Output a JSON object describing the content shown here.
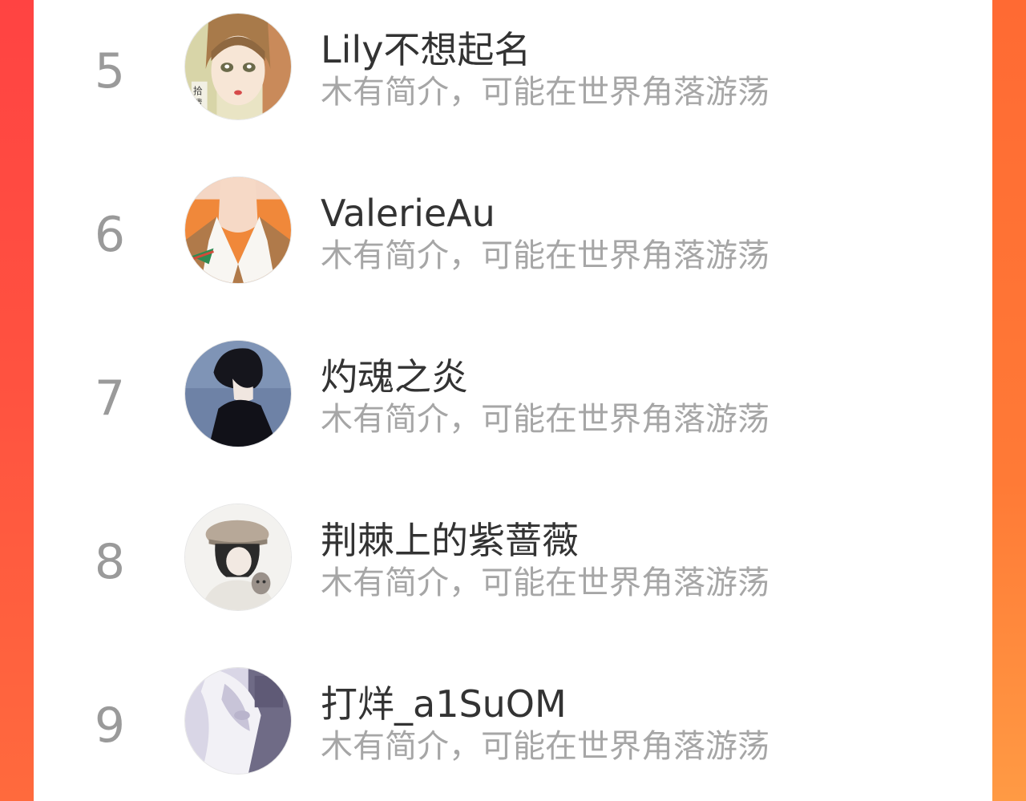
{
  "list": {
    "items": [
      {
        "rank": "5",
        "name": "Lily不想起名",
        "bio": "木有简介，可能在世界角落游荡",
        "avatar": "avatar-girl-illustration"
      },
      {
        "rank": "6",
        "name": "ValerieAu",
        "bio": "木有简介，可能在世界角落游荡",
        "avatar": "avatar-collar-illustration"
      },
      {
        "rank": "7",
        "name": "灼魂之炎",
        "bio": "木有简介，可能在世界角落游荡",
        "avatar": "avatar-boy-silhouette"
      },
      {
        "rank": "8",
        "name": "荆棘上的紫蔷薇",
        "bio": "木有简介，可能在世界角落游荡",
        "avatar": "avatar-hat-cat-illustration"
      },
      {
        "rank": "9",
        "name": "打烊_a1SuOM",
        "bio": "木有简介，可能在世界角落游荡",
        "avatar": "avatar-pale-illustration"
      }
    ]
  },
  "colors": {
    "background_accent": "#ff5a3c",
    "rank_text": "#9a9a9a",
    "name_text": "#333333",
    "bio_text": "#a6a6a6"
  }
}
